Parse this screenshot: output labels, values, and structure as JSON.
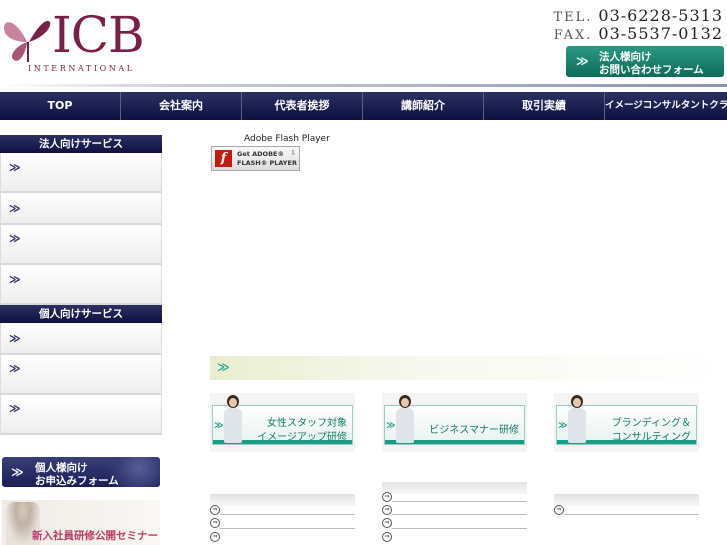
{
  "header": {
    "logo_text": "ICB",
    "logo_sub": "INTERNATIONAL",
    "tel_label": "TEL.",
    "tel": "03-6228-5313",
    "fax_label": "FAX.",
    "fax": "03-5537-0132",
    "corp_form_line1": "法人様向け",
    "corp_form_line2": "お問い合わせフォーム",
    "arrow": "≫"
  },
  "nav": {
    "items": [
      "TOP",
      "会社案内",
      "代表者挨拶",
      "講師紹介",
      "取引実績",
      "イメージコンサルタントクラブ"
    ]
  },
  "sidebar": {
    "corporate_heading": "法人向けサービス",
    "personal_heading": "個人向けサービス",
    "chevron": "≫",
    "personal_form_line1": "個人様向け",
    "personal_form_line2": "お申込みフォーム",
    "seminar_banner": "新入社員研修公開セミナー"
  },
  "main": {
    "flash_label": "Adobe Flash Player",
    "flash_badge_line1": "Get ADOBE®",
    "flash_badge_line2": "FLASH® PLAYER",
    "flash_badge_f": "f",
    "section_chevron": "≫",
    "services": [
      {
        "line1": "女性スタッフ対象",
        "line2": "イメージアップ研修"
      },
      {
        "line1": "ビジネスマナー研修",
        "line2": ""
      },
      {
        "line1": "ブランディング＆",
        "line2": "コンサルティング"
      }
    ],
    "news_icon": "⇒"
  },
  "colors": {
    "navy": "#0d1040",
    "teal": "#1b9c86",
    "brand": "#7a1f47"
  }
}
